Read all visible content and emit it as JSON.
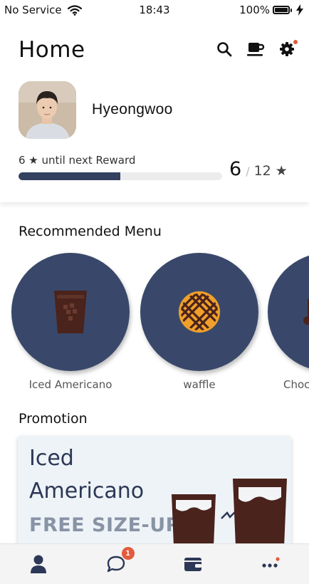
{
  "status_bar": {
    "carrier": "No Service",
    "time": "18:43",
    "battery": "100%"
  },
  "header": {
    "title": "Home",
    "icons": [
      "search-icon",
      "coffee-cup-icon",
      "gear-icon"
    ]
  },
  "profile": {
    "name": "Hyeongwoo",
    "reward_label": "6 ★ until next Reward",
    "stars_current": "6",
    "stars_separator": "/",
    "stars_max": "12 ★",
    "progress_fraction": 0.5
  },
  "recommended": {
    "title": "Recommended Menu",
    "items": [
      {
        "label": "Iced Americano",
        "icon": "iced-coffee-icon"
      },
      {
        "label": "waffle",
        "icon": "waffle-icon"
      },
      {
        "label": "Chocolate",
        "icon": "chocolate-drink-icon"
      }
    ]
  },
  "promotion": {
    "title": "Promotion",
    "card": {
      "line1": "Iced",
      "line2": "Americano",
      "line3": "FREE SIZE-UP!"
    }
  },
  "tabbar": {
    "tabs": [
      {
        "icon": "person-icon"
      },
      {
        "icon": "chat-icon",
        "badge": "1"
      },
      {
        "icon": "wallet-icon"
      },
      {
        "icon": "more-icon"
      }
    ]
  },
  "colors": {
    "accent_navy": "#39486a",
    "notification_red": "#e25b3c",
    "coffee_brown": "#4a231c",
    "waffle_orange": "#f0a02a"
  }
}
